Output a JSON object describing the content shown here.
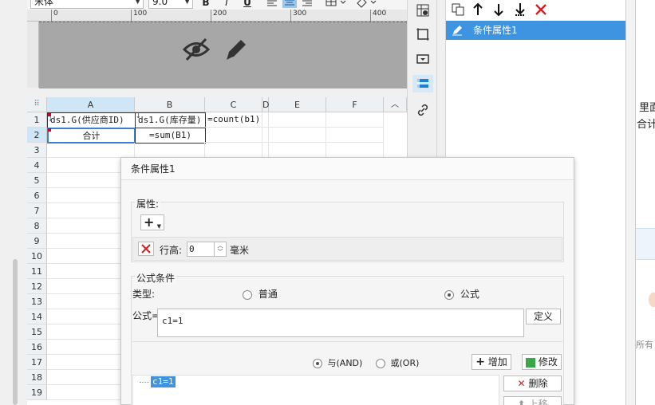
{
  "toolbar": {
    "font_name": "宋体",
    "font_size": "9.0",
    "bold": "B",
    "italic": "I",
    "underline": "U"
  },
  "ruler": {
    "ticks": [
      "0",
      "100",
      "200",
      "300",
      "400"
    ]
  },
  "grid": {
    "columns": [
      "A",
      "B",
      "C",
      "D",
      "E",
      "F"
    ],
    "rows": [
      "1",
      "2",
      "3",
      "4",
      "5",
      "6",
      "7",
      "8",
      "9",
      "10",
      "11",
      "12",
      "13",
      "14",
      "15",
      "16",
      "17",
      "18",
      "19"
    ],
    "cells": {
      "A1": "ds1.G(供应商ID)",
      "B1": "ds1.G(库存量)",
      "C1": "=count(b1)",
      "A2": "合计",
      "B2": "=sum(B1)"
    }
  },
  "right_panel": {
    "item_label": "条件属性1"
  },
  "far_right": {
    "text1": "里面",
    "text2": "合计",
    "text3": "所有"
  },
  "dialog": {
    "title": "条件属性1",
    "properties_label": "属性:",
    "add_symbol": "+",
    "row_height_label": "行高:",
    "row_height_value": "0",
    "row_height_unit": "毫米",
    "formula_condition_label": "公式条件",
    "type_label": "类型:",
    "type_normal": "普通",
    "type_formula": "公式",
    "formula_label": "公式=",
    "formula_value": "c1=1",
    "define_button": "定义",
    "and_label": "与(AND)",
    "or_label": "或(OR)",
    "add_button": "增加",
    "modify_button": "修改",
    "delete_button": "删除",
    "move_up_button": "上移",
    "condition_item": "c1=1"
  }
}
